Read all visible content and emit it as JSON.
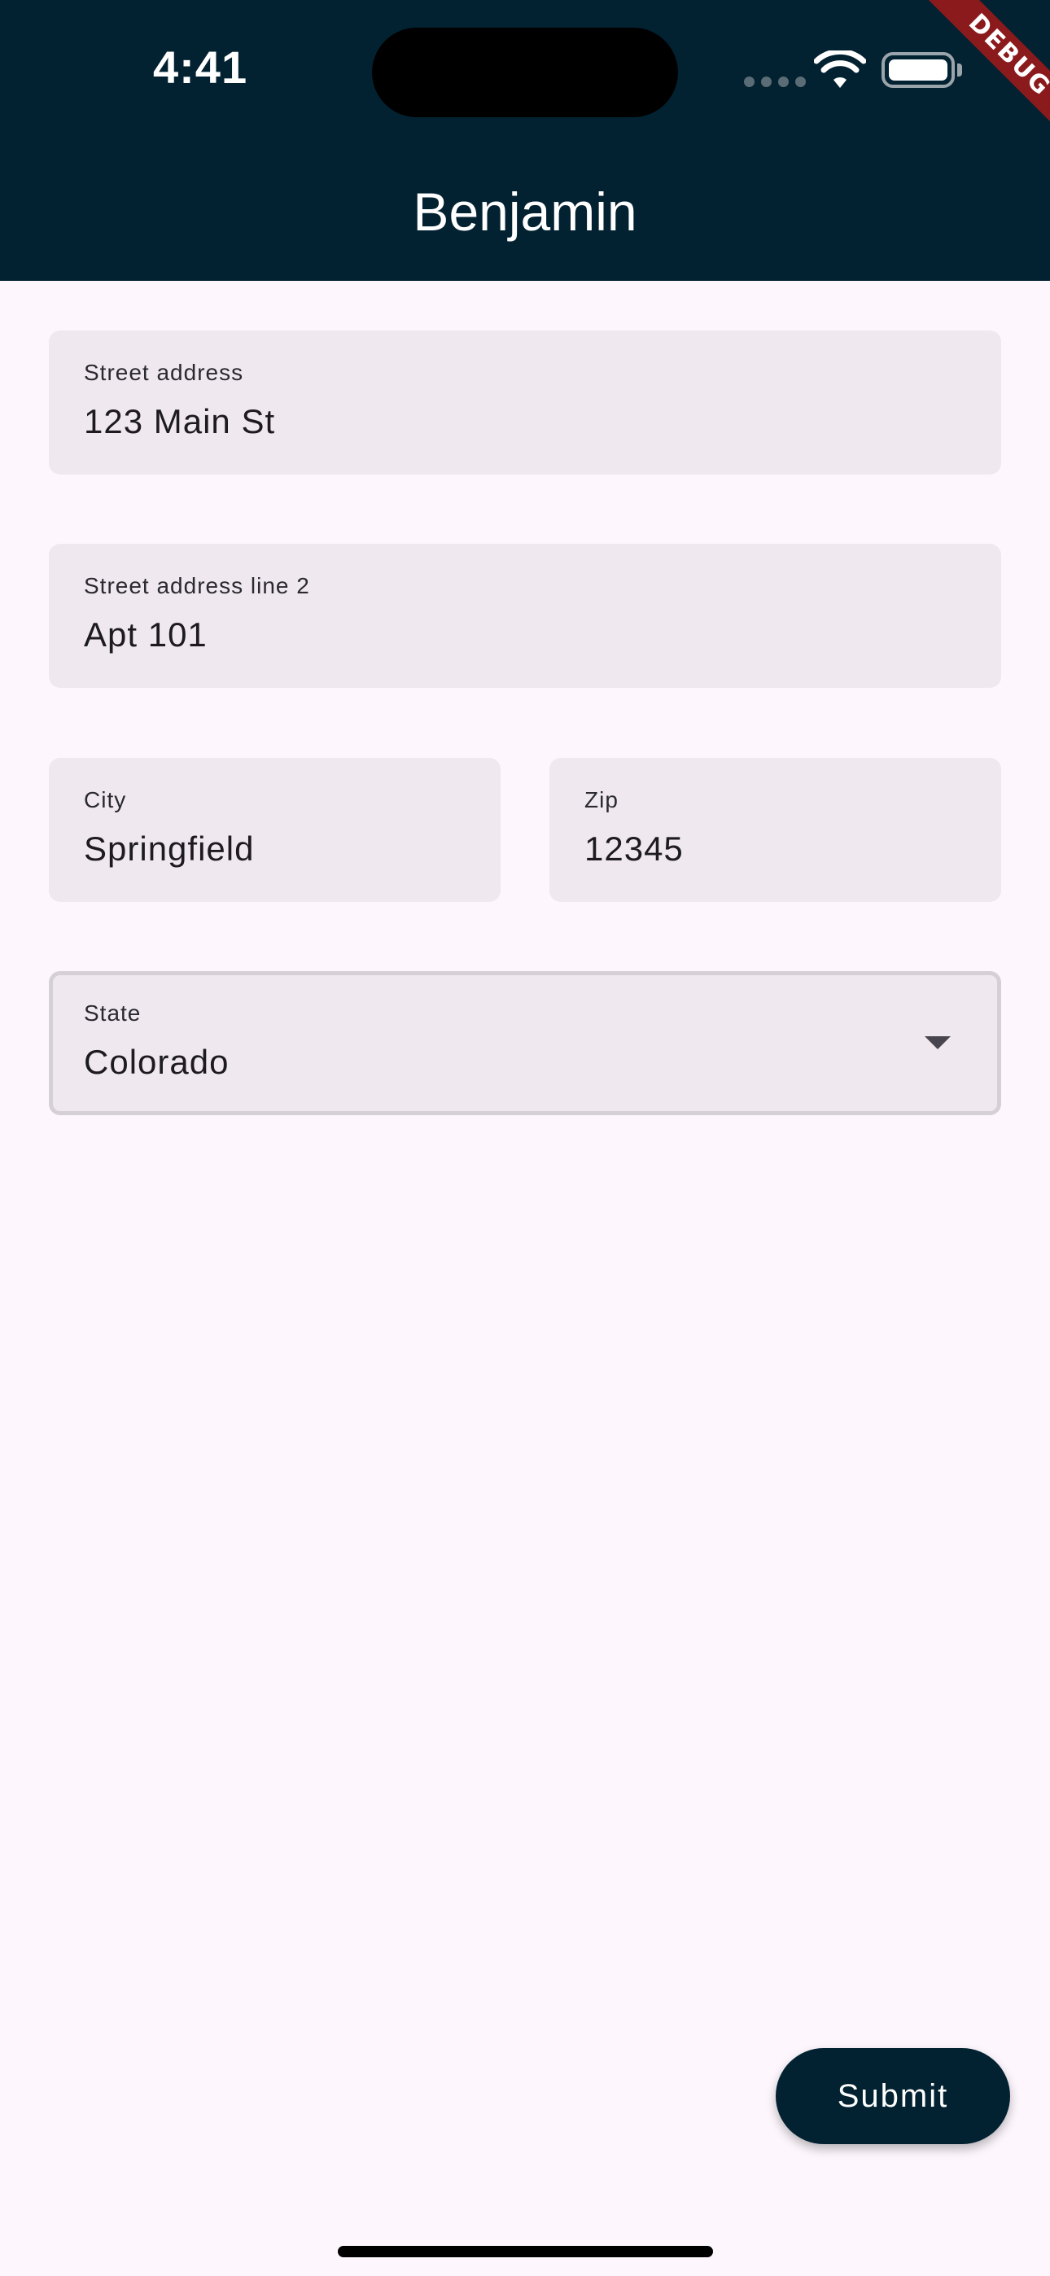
{
  "status_bar": {
    "time": "4:41"
  },
  "debug_banner": "DEBUG",
  "app_bar": {
    "title": "Benjamin"
  },
  "form": {
    "street_address": {
      "label": "Street address",
      "value": "123 Main St"
    },
    "street_address_2": {
      "label": "Street address line 2",
      "value": "Apt 101"
    },
    "city": {
      "label": "City",
      "value": "Springfield"
    },
    "zip": {
      "label": "Zip",
      "value": "12345"
    },
    "state": {
      "label": "State",
      "value": "Colorado"
    }
  },
  "submit_label": "Submit",
  "colors": {
    "app_bar": "#022232",
    "background": "#fdf7fd",
    "field_fill": "#efe9ef",
    "debug_ribbon": "#8b1a1c"
  },
  "icons": [
    "wifi-icon",
    "battery-icon",
    "dropdown-arrow-icon"
  ]
}
